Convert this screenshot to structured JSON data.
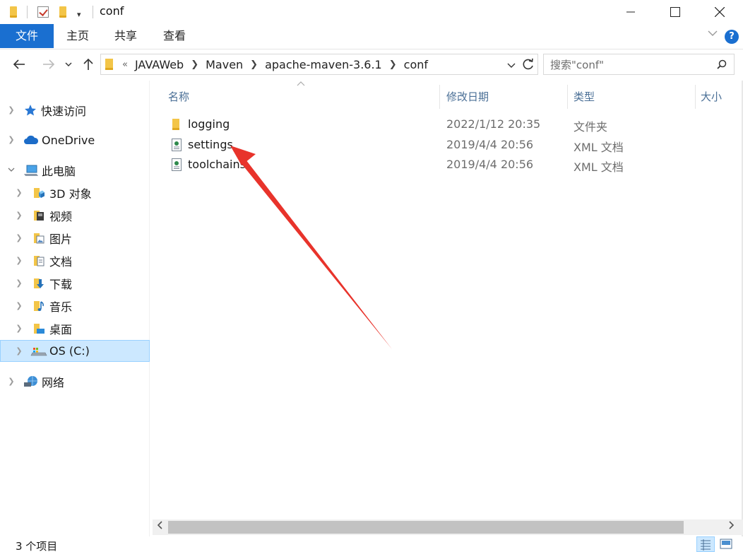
{
  "window": {
    "title": "conf"
  },
  "ribbon": {
    "tabs": [
      "文件",
      "主页",
      "共享",
      "查看"
    ],
    "help_label": "?"
  },
  "address": {
    "crumbs": [
      "JAVAWeb",
      "Maven",
      "apache-maven-3.6.1",
      "conf"
    ],
    "overflow": "«",
    "search_placeholder": "搜索\"conf\""
  },
  "nav": {
    "items": [
      {
        "label": "快速访问",
        "icon": "star-icon"
      },
      {
        "label": "OneDrive",
        "icon": "cloud-icon"
      },
      {
        "label": "此电脑",
        "icon": "computer-icon"
      },
      {
        "label": "3D 对象",
        "icon": "3d-objects-icon"
      },
      {
        "label": "视频",
        "icon": "video-icon"
      },
      {
        "label": "图片",
        "icon": "picture-icon"
      },
      {
        "label": "文档",
        "icon": "document-icon"
      },
      {
        "label": "下载",
        "icon": "download-icon"
      },
      {
        "label": "音乐",
        "icon": "music-icon"
      },
      {
        "label": "桌面",
        "icon": "desktop-icon"
      },
      {
        "label": "OS (C:)",
        "icon": "drive-icon",
        "selected": true
      },
      {
        "label": "网络",
        "icon": "network-icon"
      }
    ]
  },
  "columns": {
    "name": "名称",
    "date": "修改日期",
    "type": "类型",
    "size": "大小"
  },
  "files": [
    {
      "name": "logging",
      "date": "2022/1/12 20:35",
      "type": "文件夹",
      "icon": "folder-icon"
    },
    {
      "name": "settings",
      "date": "2019/4/4 20:56",
      "type": "XML 文档",
      "icon": "xml-file-icon"
    },
    {
      "name": "toolchains",
      "date": "2019/4/4 20:56",
      "type": "XML 文档",
      "icon": "xml-file-icon"
    }
  ],
  "status": {
    "count": "3 个项目"
  },
  "colors": {
    "accent": "#1a6fd0",
    "selection": "#cce8ff",
    "arrow": "#e8332b",
    "folder": "#f3c548"
  }
}
